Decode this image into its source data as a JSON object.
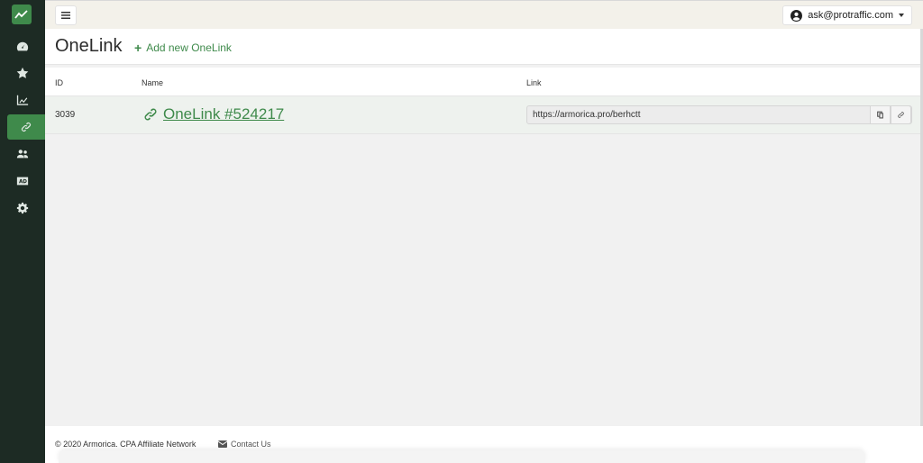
{
  "colors": {
    "accent": "#3f8a4b",
    "sidebar": "#1d2b24"
  },
  "sidebar": {
    "logo_icon": "trend-chart-icon",
    "items": [
      {
        "icon": "dashboard-icon"
      },
      {
        "icon": "star-icon"
      },
      {
        "icon": "line-chart-icon"
      },
      {
        "icon": "link-icon",
        "active": true
      },
      {
        "icon": "users-icon"
      },
      {
        "icon": "ad-icon"
      },
      {
        "icon": "gear-icon"
      }
    ]
  },
  "topbar": {
    "user_email": "ask@protraffic.com"
  },
  "header": {
    "title": "OneLink",
    "add_label": "Add new OneLink"
  },
  "table": {
    "columns": [
      "ID",
      "Name",
      "Link"
    ],
    "rows": [
      {
        "id": "3039",
        "name": "OneLink #524217",
        "link": "https://armorica.pro/berhctt"
      }
    ]
  },
  "footer": {
    "copyright": "© 2020 Armorica. CPA Affiliate Network",
    "contact": "Contact Us"
  }
}
